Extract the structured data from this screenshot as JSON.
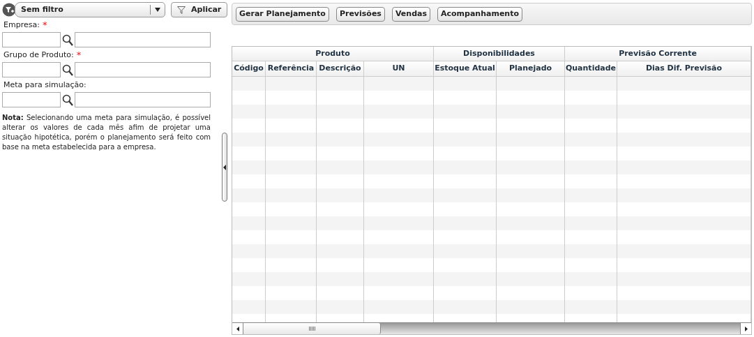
{
  "filter": {
    "value": "Sem filtro",
    "apply_label": "Aplicar"
  },
  "fields": [
    {
      "label": "Empresa:",
      "required": true
    },
    {
      "label": "Grupo de Produto:",
      "required": true
    },
    {
      "label": "Meta para simulação:",
      "required": false
    }
  ],
  "required_mark": "*",
  "note": "**Nota:** Selecionando uma meta para simulação, é possível alterar os valores de cada mês afim de projetar uma situação hipotética, porém o planejamento será feito com base na meta estabelecida para a empresa.",
  "toolbar": [
    "Gerar Planejamento",
    "Previsões",
    "Vendas",
    "Acompanhamento"
  ],
  "table": {
    "groups": [
      {
        "label": "Produto",
        "columns": [
          "Código",
          "Referência",
          "Descrição",
          "UN"
        ]
      },
      {
        "label": "Disponibilidades",
        "columns": [
          "Estoque Atual",
          "Planejado"
        ]
      },
      {
        "label": "Previsão Corrente",
        "columns": [
          "Quantidade",
          "Dias Dif. Previsão"
        ]
      }
    ]
  }
}
